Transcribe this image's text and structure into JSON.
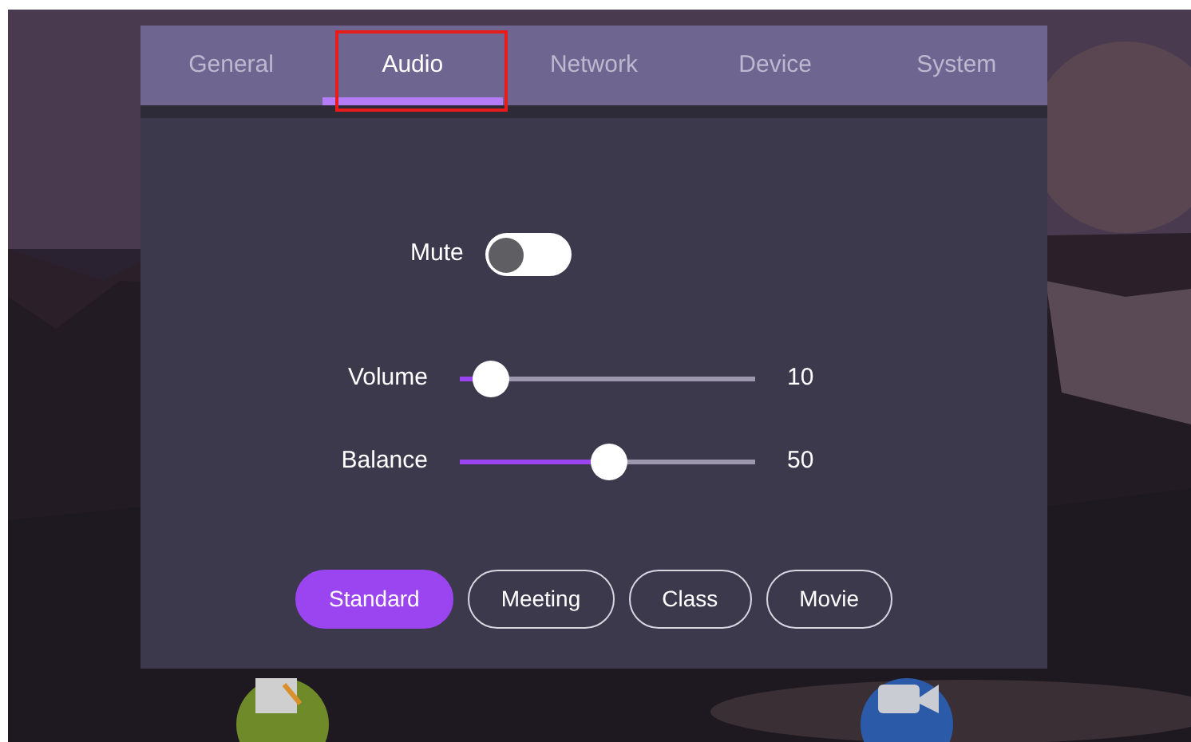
{
  "tabs": [
    {
      "label": "General",
      "selected": false,
      "highlighted": false
    },
    {
      "label": "Audio",
      "selected": true,
      "highlighted": true
    },
    {
      "label": "Network",
      "selected": false,
      "highlighted": false
    },
    {
      "label": "Device",
      "selected": false,
      "highlighted": false
    },
    {
      "label": "System",
      "selected": false,
      "highlighted": false
    }
  ],
  "mute": {
    "label": "Mute",
    "on": false
  },
  "sliders": [
    {
      "label": "Volume",
      "level": 0.1,
      "reading": "10"
    },
    {
      "label": "Balance",
      "level": 0.5,
      "reading": "50"
    }
  ],
  "presets": [
    {
      "label": "Standard",
      "selected": true
    },
    {
      "label": "Meeting",
      "selected": false
    },
    {
      "label": "Class",
      "selected": false
    },
    {
      "label": "Movie",
      "selected": false
    }
  ]
}
